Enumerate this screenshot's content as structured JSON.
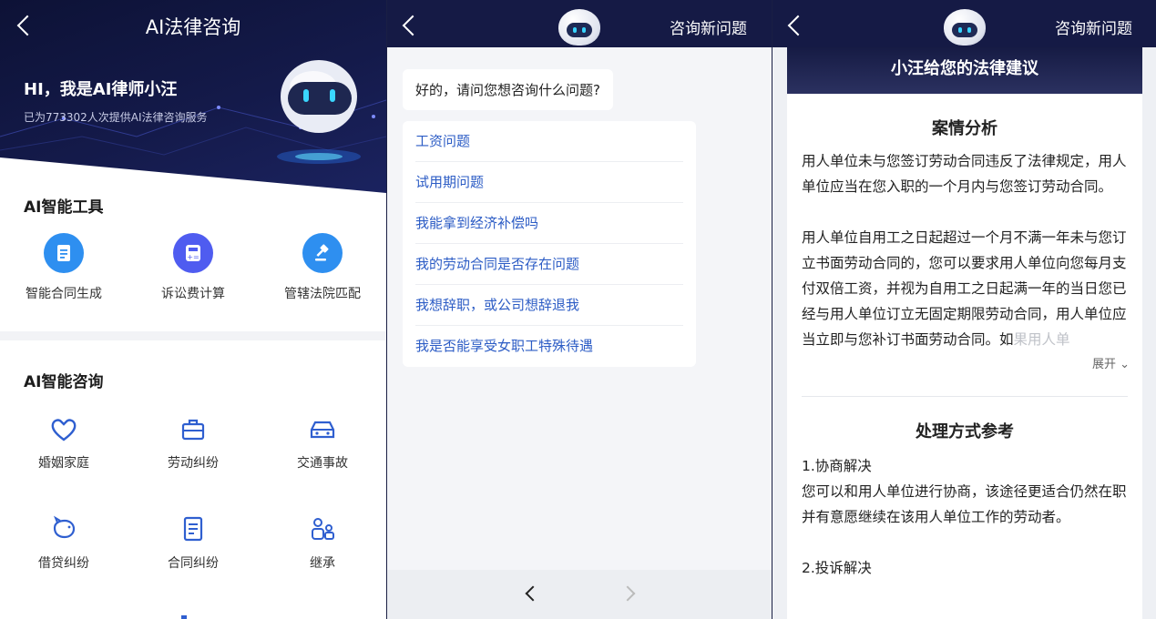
{
  "panel1": {
    "nav_title": "AI法律咨询",
    "greeting": "HI，我是AI律师小汪",
    "served_text": "已为773302人次提供AI法律咨询服务",
    "tools_title": "AI智能工具",
    "tools": [
      {
        "label": "智能合同生成",
        "icon": "document-icon",
        "color": "#2e8ff0"
      },
      {
        "label": "诉讼费计算",
        "icon": "calculator-icon",
        "color": "#4f5cf0"
      },
      {
        "label": "管辖法院匹配",
        "icon": "gavel-icon",
        "color": "#2e8ff0"
      }
    ],
    "consult_title": "AI智能咨询",
    "consult": [
      {
        "label": "婚姻家庭",
        "icon": "heart-icon"
      },
      {
        "label": "劳动纠纷",
        "icon": "briefcase-icon"
      },
      {
        "label": "交通事故",
        "icon": "car-icon"
      },
      {
        "label": "借贷纠纷",
        "icon": "piggy-bank-icon"
      },
      {
        "label": "合同纠纷",
        "icon": "contract-icon"
      },
      {
        "label": "继承",
        "icon": "people-icon"
      }
    ]
  },
  "panel2": {
    "new_question": "咨询新问题",
    "prompt": "好的，请问您想咨询什么问题?",
    "questions": [
      "工资问题",
      "试用期问题",
      "我能拿到经济补偿吗",
      "我的劳动合同是否存在问题",
      "我想辞职，或公司想辞退我",
      "我是否能享受女职工特殊待遇"
    ]
  },
  "panel3": {
    "new_question": "咨询新问题",
    "card_title": "小汪给您的法律建议",
    "analysis_title": "案情分析",
    "analysis_p1": "用人单位未与您签订劳动合同违反了法律规定，用人单位应当在您入职的一个月内与您签订劳动合同。",
    "analysis_p2": "用人单位自用工之日起超过一个月不满一年未与您订立书面劳动合同的，您可以要求用人单位向您每月支付双倍工资，并视为自用工之日起满一年的当日您已经与用人单位订立无固定期限劳动合同，用人单位应当立即与您补订书面劳动合同。如",
    "analysis_fade": "果用人单",
    "expand_label": "展开 ⌄",
    "method_title": "处理方式参考",
    "method_1_title": "1.协商解决",
    "method_1_text": "您可以和用人单位进行协商，该途径更适合仍然在职并有意愿继续在该用人单位工作的劳动者。",
    "method_2_title": "2.投诉解决"
  },
  "colors": {
    "navy": "#151a45",
    "link_blue": "#2c5cc5",
    "icon_blue": "#2e8ff0",
    "icon_indigo": "#4f5cf0"
  }
}
